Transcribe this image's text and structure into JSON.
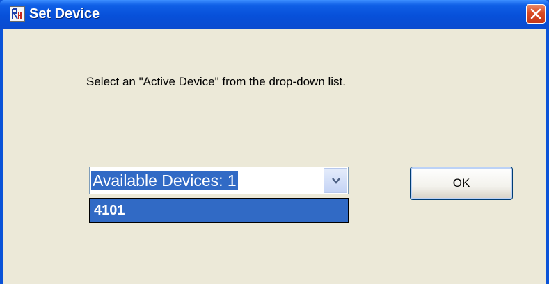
{
  "window": {
    "title": "Set Device",
    "close_icon": "close-icon",
    "app_icon": "app-icon"
  },
  "dialog": {
    "instruction": "Select an \"Active Device\" from the drop-down list.",
    "device_combo": {
      "value": "Available Devices: 1",
      "options": [
        "4101"
      ],
      "highlighted_option": "4101",
      "arrow_icon": "chevron-down-icon"
    },
    "ok_label": "OK"
  },
  "colors": {
    "titlebar": "#0a53d8",
    "client_background": "#ece9d8",
    "selection": "#316ac5",
    "close_button": "#d94a24"
  }
}
